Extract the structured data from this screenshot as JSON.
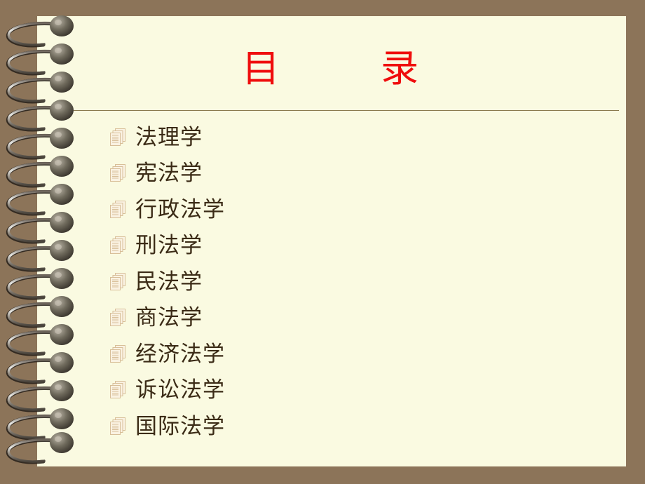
{
  "slide": {
    "title": "目        录",
    "title_color": "#ef0d0d",
    "paper_color": "#fafae1",
    "border_color": "#8c7459",
    "text_color": "#3b2b16",
    "divider_color": "#8a7a4e",
    "bullet_icon": "document-stack-icon",
    "binding": "spiral-wire-binding",
    "binding_coil_count": 16
  },
  "contents": {
    "items": [
      {
        "label": "法理学"
      },
      {
        "label": "宪法学"
      },
      {
        "label": "行政法学"
      },
      {
        "label": "刑法学"
      },
      {
        "label": "民法学"
      },
      {
        "label": "商法学"
      },
      {
        "label": "经济法学"
      },
      {
        "label": "诉讼法学"
      },
      {
        "label": "国际法学"
      }
    ]
  }
}
